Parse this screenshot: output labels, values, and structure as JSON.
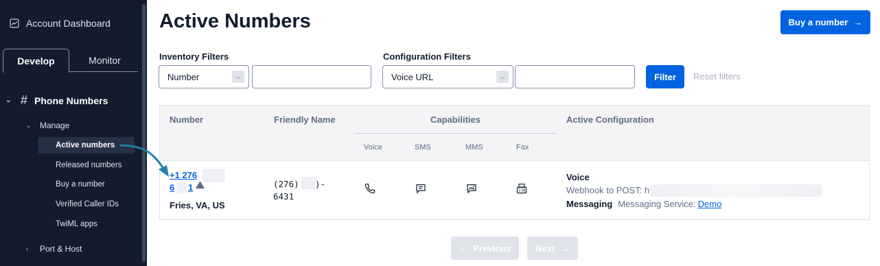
{
  "sidebar": {
    "dashboard_label": "Account Dashboard",
    "tabs": [
      {
        "label": "Develop",
        "active": true
      },
      {
        "label": "Monitor",
        "active": false
      }
    ],
    "section_label": "Phone Numbers",
    "manage_label": "Manage",
    "items": [
      {
        "label": "Active numbers",
        "active": true
      },
      {
        "label": "Released numbers"
      },
      {
        "label": "Buy a number"
      },
      {
        "label": "Verified Caller IDs"
      },
      {
        "label": "TwiML apps"
      }
    ],
    "port_label": "Port & Host"
  },
  "header": {
    "title": "Active Numbers",
    "buy_button": "Buy a number"
  },
  "filters": {
    "inventory_label": "Inventory Filters",
    "inventory_select": "Number",
    "inventory_input": "",
    "config_label": "Configuration Filters",
    "config_select": "Voice URL",
    "config_input": "",
    "filter_button": "Filter",
    "reset_label": "Reset filters"
  },
  "table": {
    "columns": {
      "number": "Number",
      "friendly": "Friendly Name",
      "capabilities": "Capabilities",
      "active_config": "Active Configuration",
      "voice": "Voice",
      "sms": "SMS",
      "mms": "MMS",
      "fax": "Fax"
    },
    "rows": [
      {
        "number_line1": "+1 276",
        "number_line2": "6",
        "number_line2b": "1",
        "location": "Fries, VA, US",
        "friendly_line1": "(276)",
        "friendly_line1b": ")-",
        "friendly_line2": "6431",
        "config_voice_title": "Voice",
        "config_voice_text": "Webhook to POST: h",
        "config_msg_title": "Messaging",
        "config_msg_text": "Messaging Service:",
        "config_msg_link": "Demo"
      }
    ]
  },
  "pagination": {
    "previous": "Previous",
    "next": "Next"
  },
  "colors": {
    "sidebar_bg": "#121c2d",
    "primary": "#0263e0",
    "annotation_arrow": "#1f7fa6"
  }
}
